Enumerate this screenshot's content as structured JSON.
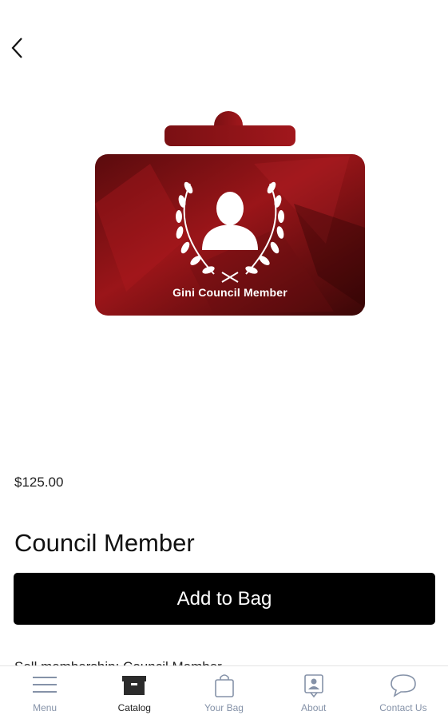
{
  "product": {
    "card_caption": "Gini Council Member",
    "price": "$125.00",
    "title": "Council Member",
    "add_button": "Add to Bag",
    "description": "Sell membership: Council Member"
  },
  "tabs": [
    {
      "label": "Menu",
      "icon": "menu-icon",
      "active": false
    },
    {
      "label": "Catalog",
      "icon": "catalog-icon",
      "active": true
    },
    {
      "label": "Your Bag",
      "icon": "bag-icon",
      "active": false
    },
    {
      "label": "About",
      "icon": "about-icon",
      "active": false
    },
    {
      "label": "Contact Us",
      "icon": "chat-icon",
      "active": false
    }
  ],
  "colors": {
    "card_red": "#8e1418",
    "card_dark": "#3a0707",
    "tab_inactive": "#8592a8",
    "button": "#000000"
  }
}
